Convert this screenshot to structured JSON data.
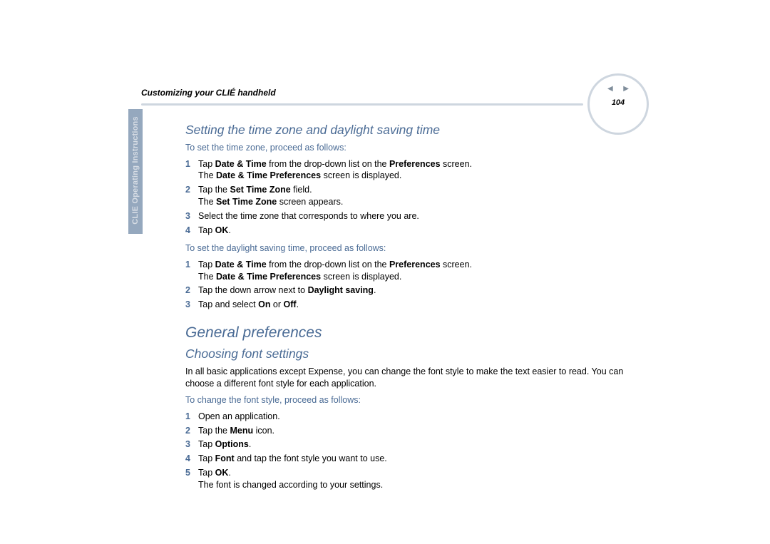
{
  "header": {
    "chapter": "Customizing your CLIÉ handheld",
    "page_number": "104",
    "side_tab": "CLIE Operating Instructions"
  },
  "section1": {
    "heading": "Setting the time zone and daylight saving time",
    "lead1": "To set the time zone, proceed as follows:",
    "steps1": {
      "s1_a": "Tap ",
      "s1_b": "Date & Time",
      "s1_c": " from the drop-down list on the ",
      "s1_d": "Preferences",
      "s1_e": " screen.",
      "s1_f": "The ",
      "s1_g": "Date & Time Preferences",
      "s1_h": " screen is displayed.",
      "s2_a": "Tap the ",
      "s2_b": "Set Time Zone",
      "s2_c": " field.",
      "s2_d": "The ",
      "s2_e": "Set Time Zone",
      "s2_f": " screen appears.",
      "s3": "Select the time zone that corresponds to where you are.",
      "s4_a": "Tap ",
      "s4_b": "OK",
      "s4_c": "."
    },
    "lead2": "To set the daylight saving time, proceed as follows:",
    "steps2": {
      "s1_a": "Tap ",
      "s1_b": "Date & Time",
      "s1_c": " from the drop-down list on the ",
      "s1_d": "Preferences",
      "s1_e": " screen.",
      "s1_f": "The ",
      "s1_g": "Date & Time Preferences",
      "s1_h": " screen is displayed.",
      "s2_a": "Tap the down arrow next to ",
      "s2_b": "Daylight saving",
      "s2_c": ".",
      "s3_a": "Tap and select ",
      "s3_b": "On",
      "s3_c": " or ",
      "s3_d": "Off",
      "s3_e": "."
    }
  },
  "section2": {
    "heading": "General preferences",
    "subheading": "Choosing font settings",
    "intro": "In all basic applications except Expense, you can change the font style to make the text easier to read. You can choose a different font style for each application.",
    "lead": "To change the font style, proceed as follows:",
    "steps": {
      "s1": "Open an application.",
      "s2_a": "Tap the ",
      "s2_b": "Menu",
      "s2_c": " icon.",
      "s3_a": "Tap ",
      "s3_b": "Options",
      "s3_c": ".",
      "s4_a": "Tap ",
      "s4_b": "Font",
      "s4_c": " and tap the font style you want to use.",
      "s5_a": "Tap ",
      "s5_b": "OK",
      "s5_c": ".",
      "s5_note": "The font is changed according to your settings."
    }
  },
  "nums": {
    "n1": "1",
    "n2": "2",
    "n3": "3",
    "n4": "4",
    "n5": "5"
  }
}
